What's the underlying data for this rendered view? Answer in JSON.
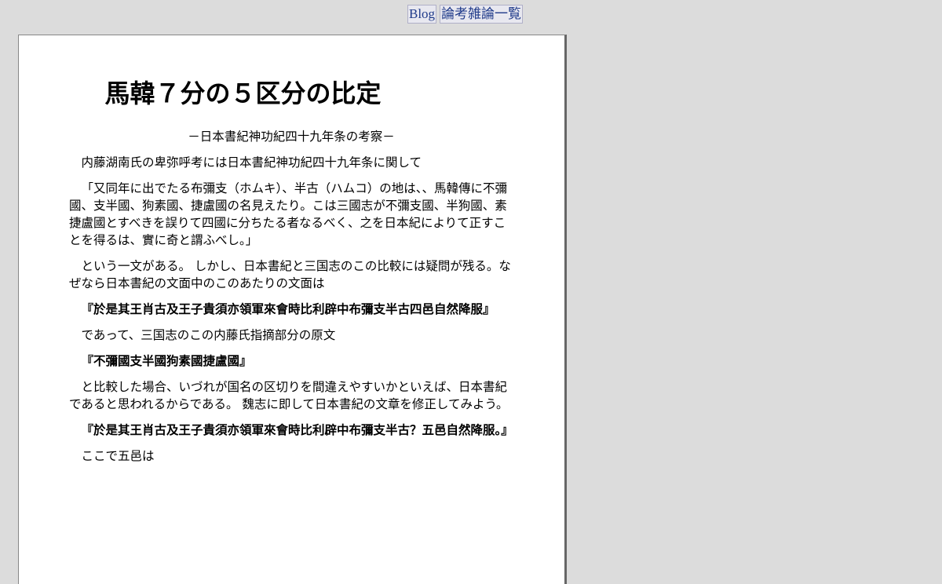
{
  "nav": {
    "blog": "Blog",
    "ronko": "論考雑論一覧"
  },
  "article": {
    "title": "馬韓７分の５区分の比定",
    "subtitle": "－日本書紀神功紀四十九年条の考察－",
    "paragraphs": [
      "内藤湖南氏の卑弥呼考には日本書紀神功紀四十九年条に関して",
      "「又同年に出でたる布彌支（ホムキ）、半古（ハムコ）の地は、、馬韓傳に不彌國、支半國、狗素國、捷盧國の名見えたり。こは三國志が不彌支國、半狗國、素捷盧國とすべきを誤りて四國に分ちたる者なるべく、之を日本紀によりて正すことを得るは、實に奇と謂ふべし。」",
      "という一文がある。 しかし、日本書紀と三国志のこの比較には疑問が残る。なぜなら日本書紀の文面中のこのあたりの文面は",
      "『於是其王肖古及王子貴須亦領軍來會時比利辟中布彌支半古四邑自然降服』",
      "であって、三国志のこの内藤氏指摘部分の原文",
      "『不彌國支半國狗素國捷盧國』",
      "と比較した場合、いづれが国名の区切りを間違えやすいかといえば、日本書紀であると思われるからである。 魏志に即して日本書紀の文章を修正してみよう。",
      "『於是其王肖古及王子貴須亦領軍來會時比利辟中布彌支半古？五邑自然降服。』",
      "ここで五邑は"
    ]
  }
}
